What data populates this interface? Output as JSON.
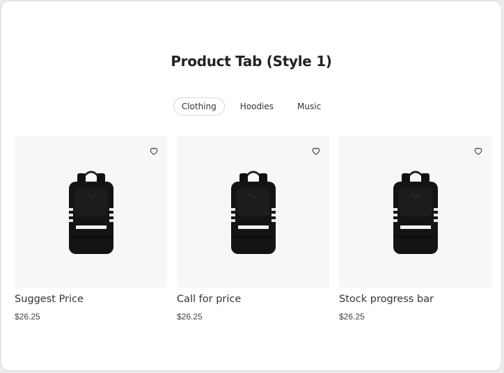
{
  "section": {
    "title": "Product Tab (Style 1)"
  },
  "tabs": [
    {
      "label": "Clothing",
      "active": true
    },
    {
      "label": "Hoodies",
      "active": false
    },
    {
      "label": "Music",
      "active": false
    }
  ],
  "products": [
    {
      "name": "Suggest Price",
      "price": "$26.25",
      "image": "black-backpack",
      "wishlist_icon": "heart-outline-icon"
    },
    {
      "name": "Call for price",
      "price": "$26.25",
      "image": "black-backpack",
      "wishlist_icon": "heart-outline-icon"
    },
    {
      "name": "Stock progress bar",
      "price": "$26.25",
      "image": "black-backpack",
      "wishlist_icon": "heart-outline-icon"
    }
  ],
  "colors": {
    "background": "#ffffff",
    "image_bg": "#f7f7f5",
    "text": "#222222",
    "tab_border": "#d8d8d8"
  }
}
